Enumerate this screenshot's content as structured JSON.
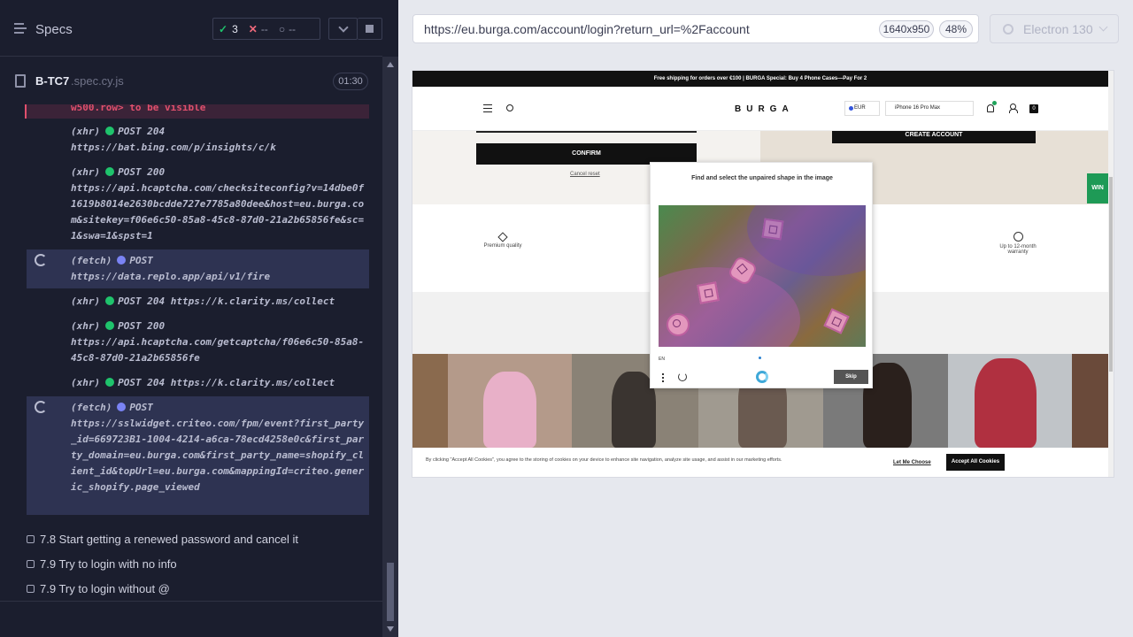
{
  "runner": {
    "specs_label": "Specs",
    "stats": {
      "passed": "3",
      "failed": "--",
      "pending": "--"
    },
    "spec_file": {
      "name": "B-TC7",
      "ext": ".spec.cy.js",
      "duration": "01:30"
    },
    "error_line": "w500.row> to be visible",
    "commands": [
      {
        "kind": "(xhr)",
        "method": "POST 204",
        "url": "https://bat.bing.com/p/insights/c/k"
      },
      {
        "kind": "(xhr)",
        "method": "POST 200",
        "url": "https://api.hcaptcha.com/checksiteconfig?v=14dbe0f1619b8014e2630bcdde727e7785a80dee&host=eu.burga.com&sitekey=f06e6c50-85a8-45c8-87d0-21a2b65856fe&sc=1&swa=1&spst=1"
      },
      {
        "kind": "(fetch)",
        "method": "POST",
        "url": "https://data.replo.app/api/v1/fire"
      },
      {
        "kind": "(xhr)",
        "method": "POST 204",
        "url": "https://k.clarity.ms/collect"
      },
      {
        "kind": "(xhr)",
        "method": "POST 200",
        "url": "https://api.hcaptcha.com/getcaptcha/f06e6c50-85a8-45c8-87d0-21a2b65856fe"
      },
      {
        "kind": "(xhr)",
        "method": "POST 204",
        "url": "https://k.clarity.ms/collect"
      },
      {
        "kind": "(fetch)",
        "method": "POST",
        "url": "https://sslwidget.criteo.com/fpm/event?first_party_id=669723B1-1004-4214-a6ca-78ecd4258e0c&first_party_domain=eu.burga.com&first_party_name=shopify_client_id&topUrl=eu.burga.com&mappingId=criteo.generic_shopify.page_viewed"
      }
    ],
    "tests": [
      "7.8 Start getting a renewed password and cancel it",
      "7.9 Try to login with no info",
      "7.9 Try to login without @"
    ]
  },
  "address_bar": {
    "url": "https://eu.burga.com/account/login?return_url=%2Faccount",
    "viewport": "1640x950",
    "scale": "48%",
    "browser": "Electron 130"
  },
  "site": {
    "announcement": "Free shipping for orders over €100  |  BURGA Special: Buy 4 Phone Cases—Pay For 2",
    "logo": "BURGA",
    "currency": "EUR",
    "device": "iPhone 16 Pro Max",
    "cart_count": "0",
    "confirm_button": "CONFIRM",
    "cancel_link": "Cancel reset",
    "create_account": "CREATE ACCOUNT",
    "feature_quality": "Premium quality",
    "feature_warranty": "Up to 12-month warranty",
    "cookie_text": "By clicking \"Accept All Cookies\", you agree to the storing of cookies on your device to enhance site navigation, analyze site usage, and assist in our marketing efforts.",
    "let_me_choose": "Let Me Choose",
    "accept_all": "Accept All Cookies",
    "side_tab": "WIN"
  },
  "captcha": {
    "prompt": "Find and select the unpaired shape in the image",
    "lang": "EN",
    "skip": "Skip"
  },
  "colors": {
    "pass": "#1fc36c",
    "fail": "#f06a7c",
    "xhr_dot": "#1fc36c",
    "fetch_dot": "#7a83f5"
  }
}
